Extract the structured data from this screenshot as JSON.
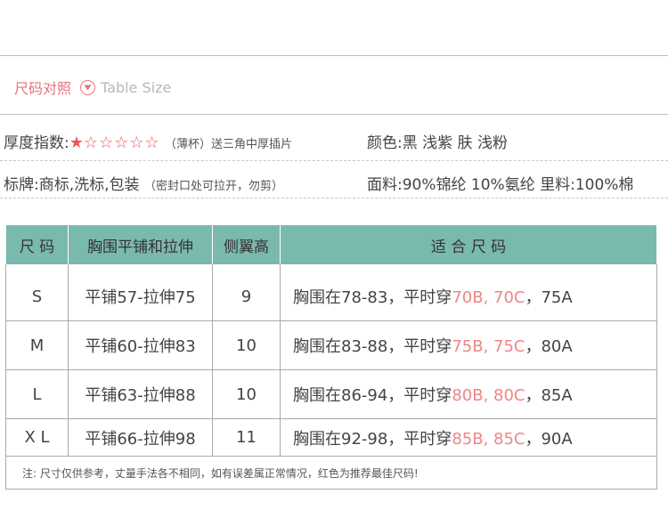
{
  "header": {
    "title": "尺码对照",
    "subtitle": "Table Size"
  },
  "info": {
    "thickness_label": "厚度指数:",
    "thickness_rating": 1,
    "thickness_max": 6,
    "thickness_note": "（薄杯）送三角中厚插片",
    "color_label": "颜色:",
    "colors": "黑 浅紫 肤 浅粉",
    "tag_label": "标牌:",
    "tag_value": "商标,洗标,包装",
    "tag_note": "（密封口处可拉开，勿剪）",
    "fabric": "面料:90%锦纶 10%氨纶 里料:100%棉"
  },
  "table": {
    "headers": [
      "尺 码",
      "胸围平铺和拉伸",
      "侧翼高",
      "适 合 尺 码"
    ],
    "rows": [
      {
        "size": "S",
        "measure": "平铺57-拉伸75",
        "wing": "9",
        "fit_prefix": "胸围在78-83，平时穿",
        "fit_red": "70B, 70C",
        "fit_suffix": "，75A"
      },
      {
        "size": "M",
        "measure": "平铺60-拉伸83",
        "wing": "10",
        "fit_prefix": "胸围在83-88，平时穿",
        "fit_red": "75B, 75C",
        "fit_suffix": "，80A"
      },
      {
        "size": "L",
        "measure": "平铺63-拉伸88",
        "wing": "10",
        "fit_prefix": "胸围在86-94，平时穿",
        "fit_red": "80B, 80C",
        "fit_suffix": "，85A"
      },
      {
        "size": "X L",
        "measure": "平铺66-拉伸98",
        "wing": "11",
        "fit_prefix": "胸围在92-98，平时穿",
        "fit_red": "85B, 85C",
        "fit_suffix": "，90A"
      }
    ],
    "note": "注: 尺寸仅供参考，丈量手法各不相同，如有误差属正常情况，红色为推荐最佳尺码!"
  },
  "colors": {
    "accent": "#e8727c",
    "header_bg": "#7ab9ae",
    "recommend": "#f08585"
  },
  "icons": {
    "section": "chevron-down-circle-icon"
  }
}
